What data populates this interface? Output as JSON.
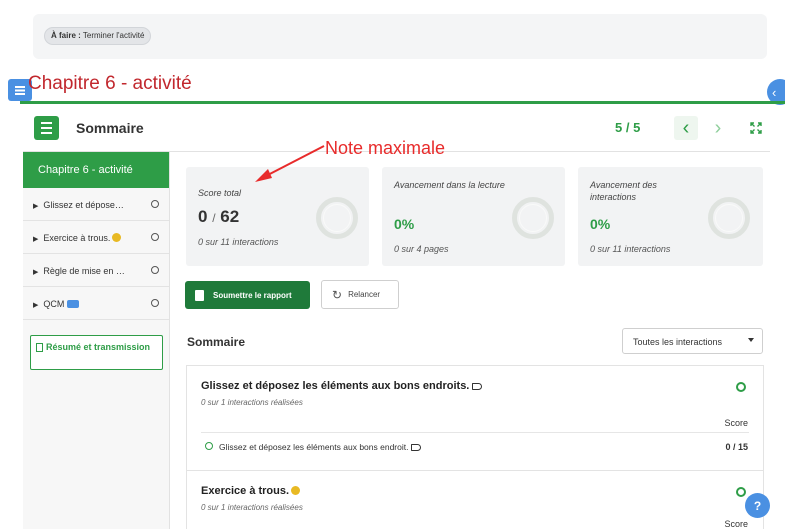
{
  "todo": {
    "label": "À faire :",
    "text": "Terminer l'activité"
  },
  "page_title": "Chapitre 6 - activité",
  "topbar": {
    "title": "Sommaire",
    "pager": "5 / 5"
  },
  "sidebar": {
    "title": "Chapitre 6 - activité",
    "items": [
      {
        "label": "Glissez et dépose…"
      },
      {
        "label": "Exercice à trous."
      },
      {
        "label": "Règle de mise en …"
      },
      {
        "label": "QCM"
      }
    ],
    "resume": "Résumé et transmission"
  },
  "cards": [
    {
      "label": "Score total",
      "value": "0",
      "slash": "/",
      "max": "62",
      "sub": "0 sur 11 interactions",
      "progress": 0
    },
    {
      "label": "Avancement dans la lecture",
      "value": "0%",
      "sub": "0 sur 4 pages",
      "progress": 0
    },
    {
      "label": "Avancement des interactions",
      "value": "0%",
      "sub": "0 sur 11 interactions",
      "progress": 0
    }
  ],
  "annotation": {
    "text": "Note maximale",
    "color": "#e82b2b"
  },
  "actions": {
    "submit": "Soumettre le rapport",
    "retry": "Relancer"
  },
  "summary": {
    "title": "Sommaire",
    "filter": "Toutes les interactions",
    "sections": [
      {
        "title": "Glissez et déposez les éléments aux bons endroits.",
        "sub": "0 sur 1 interactions réalisées",
        "score_head": "Score",
        "rows": [
          {
            "text": "Glissez et déposez les éléments aux bons endroit.",
            "score": "0 / 15"
          }
        ]
      },
      {
        "title": "Exercice à trous.",
        "sub": "0 sur 1 interactions réalisées",
        "score_head": "Score"
      }
    ]
  },
  "help": "?",
  "colors": {
    "brand_green": "#2e9d47",
    "title_red": "#c1272d",
    "accent_blue": "#4a90e2"
  }
}
